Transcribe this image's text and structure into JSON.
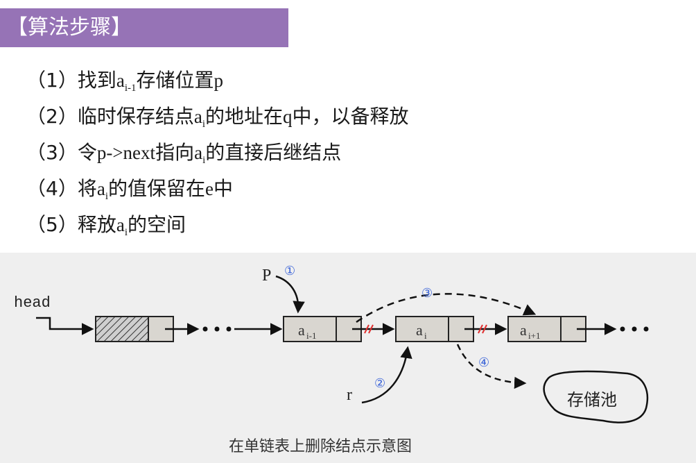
{
  "header": {
    "title": "【算法步骤】"
  },
  "steps": [
    {
      "num": "（1）",
      "text1": "找到",
      "var": "a",
      "sub": "i-1",
      "text2": "存储位置",
      "tail": "p"
    },
    {
      "num": "（2）",
      "text1": "临时保存结点",
      "var": "a",
      "sub": "i",
      "text2": "的地址在",
      "var2": "q",
      "text3": "中，以备释放"
    },
    {
      "num": "（3）",
      "text1": "令",
      "var0": "p->next",
      "text1b": "指向",
      "var": "a",
      "sub": "i",
      "text2": "的直接后继结点"
    },
    {
      "num": "（4）",
      "text1": "将",
      "var": "a",
      "sub": "i",
      "text2": "的值保留在",
      "var2": "e",
      "text3": "中"
    },
    {
      "num": "（5）",
      "text1": "释放",
      "var": "a",
      "sub": "i",
      "text2": "的空间"
    }
  ],
  "diagram": {
    "head_label": "head",
    "p_label": "P",
    "r_label": "r",
    "node1": {
      "var": "a",
      "sub": "i-1"
    },
    "node2": {
      "var": "a",
      "sub": "i"
    },
    "node3": {
      "var": "a",
      "sub": "i+1"
    },
    "step_markers": [
      "①",
      "②",
      "③",
      "④"
    ],
    "pool_label": "存储池",
    "caption": "在单链表上删除结点示意图",
    "colors": {
      "marker": "#3a63d8",
      "cut": "#e03030",
      "node_fill": "#d9d6d0"
    }
  }
}
